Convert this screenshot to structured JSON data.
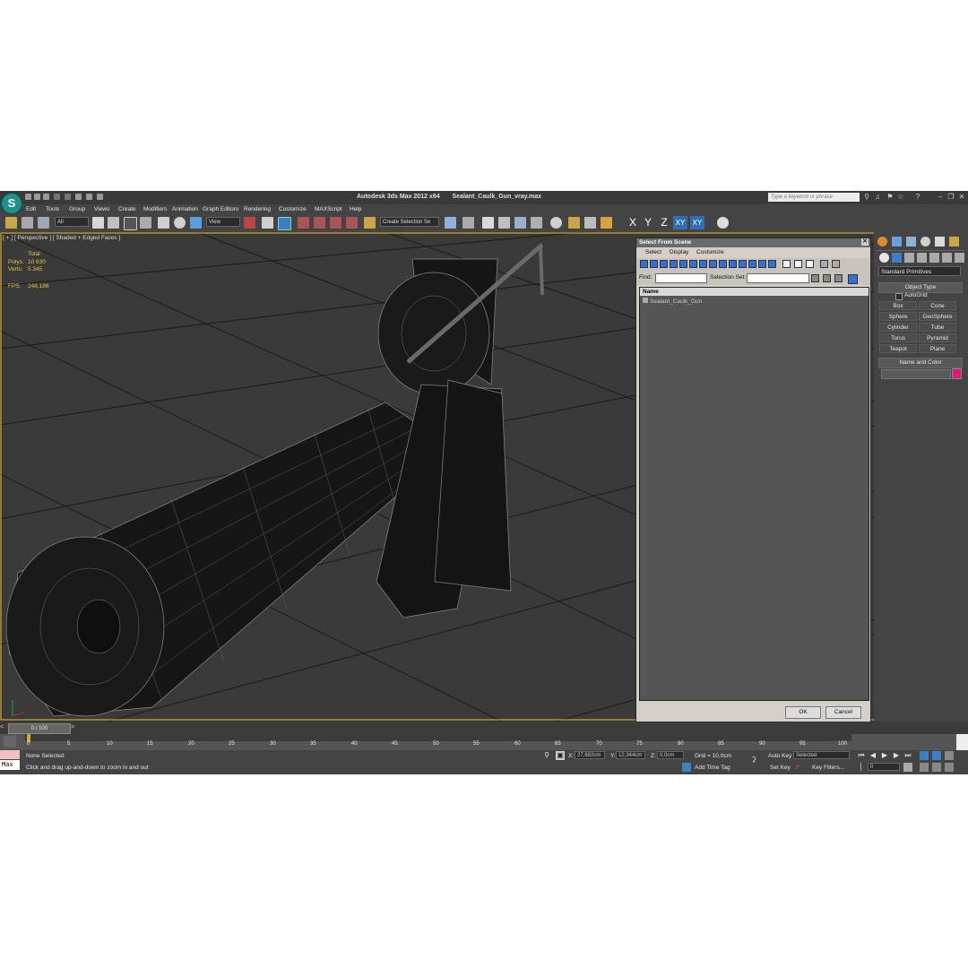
{
  "title_bar": {
    "app_title": "Autodesk 3ds Max  2012 x64",
    "file_name": "Sealant_Caulk_Gun_vray.max",
    "help_search_placeholder": "Type a keyword or phrase"
  },
  "menu": [
    "Edit",
    "Tools",
    "Group",
    "Views",
    "Create",
    "Modifiers",
    "Animation",
    "Graph Editors",
    "Rendering",
    "Customize",
    "MAXScript",
    "Help"
  ],
  "toolbar": {
    "selection_filter": "All",
    "ref_coord": "View",
    "named_selection": "Create Selection Se",
    "axes": [
      "X",
      "Y",
      "Z",
      "XY",
      "XY"
    ]
  },
  "viewport": {
    "label": "[ + ] [ Perspective ] [ Shaded + Edged Faces ]",
    "stats_header": "Total",
    "polys_label": "Polys:",
    "polys_value": "10 630",
    "verts_label": "Verts:",
    "verts_value": "5 345",
    "fps_label": "FPS:",
    "fps_value": "248,186"
  },
  "dialog": {
    "title": "Select From Scene",
    "menu": [
      "Select",
      "Display",
      "Customize"
    ],
    "find_label": "Find:",
    "selection_set_label": "Selection Set:",
    "list_header": "Name",
    "items": [
      "Sealant_Caulk_Gun"
    ],
    "ok": "OK",
    "cancel": "Cancel"
  },
  "command_panel": {
    "category": "Standard Primitives",
    "object_type_header": "Object Type",
    "autogrid": "AutoGrid",
    "buttons": [
      "Box",
      "Cone",
      "Sphere",
      "GeoSphere",
      "Cylinder",
      "Tube",
      "Torus",
      "Pyramid",
      "Teapot",
      "Plane"
    ],
    "name_color_header": "Name and Color",
    "color_swatch": "#e0167a"
  },
  "timeline": {
    "frame_counter": "0 / 100",
    "ticks": [
      "0",
      "5",
      "10",
      "15",
      "20",
      "25",
      "30",
      "35",
      "40",
      "45",
      "50",
      "55",
      "60",
      "65",
      "70",
      "75",
      "80",
      "85",
      "90",
      "95",
      "100"
    ]
  },
  "status": {
    "maxscript": "Max",
    "selection": "None Selected",
    "prompt": "Click and drag up-and-down to zoom in and out",
    "x_label": "X:",
    "x_value": "27,682cm",
    "y_label": "Y:",
    "y_value": "12,344cm",
    "z_label": "Z:",
    "z_value": "0,0cm",
    "grid": "Grid = 10,0cm",
    "add_time_tag": "Add Time Tag",
    "auto_key": "Auto Key",
    "auto_key_mode": "Selected",
    "set_key": "Set Key",
    "key_filters": "Key Filters...",
    "current_frame": "0"
  }
}
